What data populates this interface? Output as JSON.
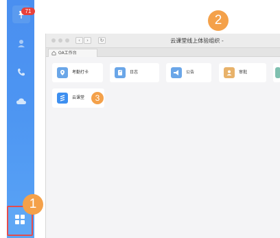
{
  "sidebar": {
    "badge_count": "71",
    "icons": [
      "pin-icon",
      "contacts-icon",
      "phone-icon",
      "cloud-icon",
      "apps-grid-icon"
    ]
  },
  "window": {
    "title": "云课堂线上体验组织 -",
    "tab_label": "OA工作台",
    "apps": [
      {
        "label": "考勤打卡",
        "icon": "location-pin-icon",
        "color": "#6aa6e8"
      },
      {
        "label": "日志",
        "icon": "notebook-icon",
        "color": "#6aa6e8"
      },
      {
        "label": "公告",
        "icon": "megaphone-icon",
        "color": "#6aa6e8"
      },
      {
        "label": "审批",
        "icon": "person-icon",
        "color": "#e8b26a"
      },
      {
        "label": "云课堂",
        "icon": "stripes-icon",
        "color": "#3d8ff0"
      }
    ]
  },
  "markers": {
    "m1": "1",
    "m2": "2",
    "m3": "3"
  },
  "colors": {
    "sidebar_blue": "#4d95f2",
    "highlight_red": "#e54b4b",
    "marker_orange": "#f4a14a"
  }
}
